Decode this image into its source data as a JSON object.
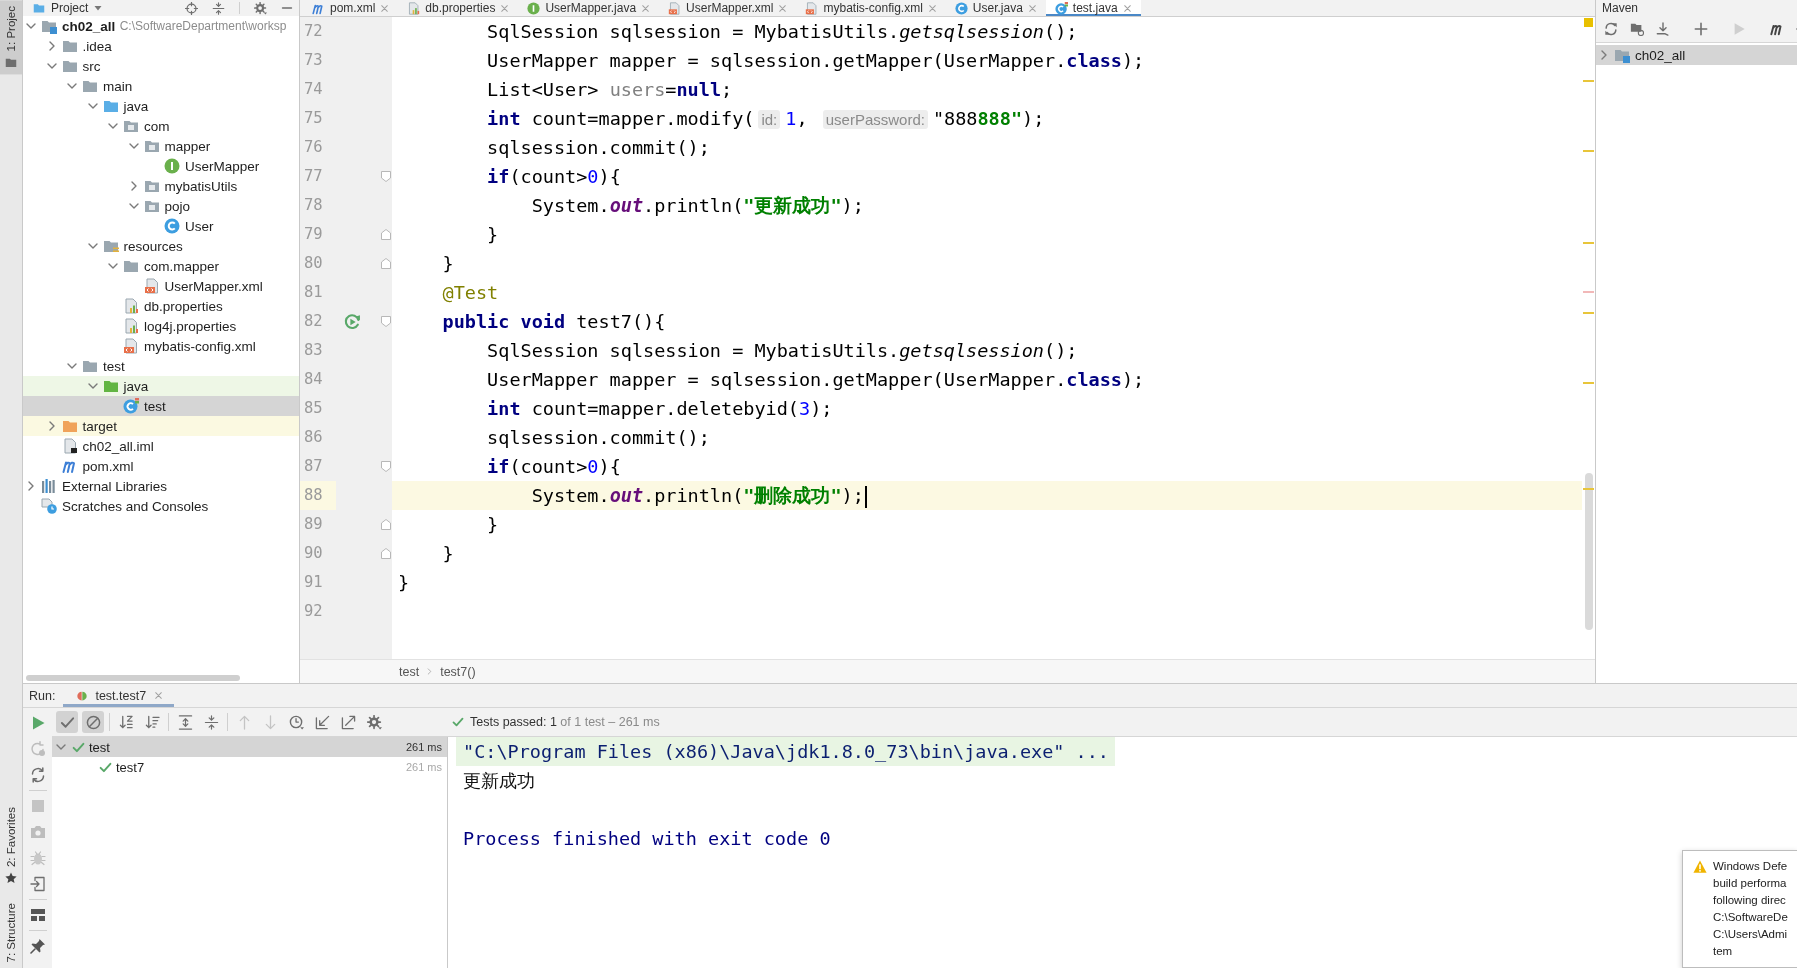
{
  "left_stripe": {
    "buttons": [
      {
        "label": "1: Projec",
        "kind": "project",
        "selected": true
      },
      {
        "label": "2: Favorites",
        "kind": "favorites",
        "selected": false
      },
      {
        "label": "7: Structure",
        "kind": "structure",
        "selected": false
      }
    ]
  },
  "project": {
    "title": "Project",
    "tree": [
      {
        "label": "ch02_all",
        "path": "C:\\SoftwareDepartment\\worksp",
        "kind": "module",
        "expanded": true,
        "selected": false,
        "children": [
          {
            "label": ".idea",
            "kind": "folder",
            "expanded": false,
            "selected": false
          },
          {
            "label": "src",
            "kind": "folder",
            "expanded": true,
            "selected": false,
            "children": [
              {
                "label": "main",
                "kind": "folder",
                "expanded": true,
                "selected": false,
                "children": [
                  {
                    "label": "java",
                    "kind": "source-folder",
                    "expanded": true,
                    "selected": false,
                    "children": [
                      {
                        "label": "com",
                        "kind": "package",
                        "expanded": true,
                        "selected": false,
                        "children": [
                          {
                            "label": "mapper",
                            "kind": "package",
                            "expanded": true,
                            "selected": false,
                            "children": [
                              {
                                "label": "UserMapper",
                                "kind": "interface",
                                "selected": false
                              }
                            ]
                          },
                          {
                            "label": "mybatisUtils",
                            "kind": "package",
                            "expanded": false,
                            "selected": false
                          },
                          {
                            "label": "pojo",
                            "kind": "package",
                            "expanded": true,
                            "selected": false,
                            "children": [
                              {
                                "label": "User",
                                "kind": "class",
                                "selected": false
                              }
                            ]
                          }
                        ]
                      }
                    ]
                  },
                  {
                    "label": "resources",
                    "kind": "resources-folder",
                    "expanded": true,
                    "selected": false,
                    "children": [
                      {
                        "label": "com.mapper",
                        "kind": "folder",
                        "expanded": true,
                        "selected": false,
                        "children": [
                          {
                            "label": "UserMapper.xml",
                            "kind": "xml",
                            "selected": false
                          }
                        ]
                      },
                      {
                        "label": "db.properties",
                        "kind": "properties",
                        "selected": false
                      },
                      {
                        "label": "log4j.properties",
                        "kind": "properties",
                        "selected": false
                      },
                      {
                        "label": "mybatis-config.xml",
                        "kind": "xml",
                        "selected": false
                      }
                    ]
                  }
                ]
              },
              {
                "label": "test",
                "kind": "folder",
                "expanded": true,
                "selected": false,
                "children": [
                  {
                    "label": "java",
                    "kind": "test-folder",
                    "expanded": true,
                    "selected": false,
                    "children": [
                      {
                        "label": "test",
                        "kind": "test-class",
                        "selected": true
                      }
                    ]
                  }
                ]
              }
            ]
          },
          {
            "label": "target",
            "kind": "excluded-folder",
            "expanded": false,
            "selected": false
          },
          {
            "label": "ch02_all.iml",
            "kind": "iml",
            "selected": false
          },
          {
            "label": "pom.xml",
            "kind": "maven",
            "selected": false
          }
        ]
      },
      {
        "label": "External Libraries",
        "kind": "libraries",
        "expanded": false,
        "selected": false
      },
      {
        "label": "Scratches and Consoles",
        "kind": "scratches",
        "selected": false
      }
    ]
  },
  "editor_tabs": [
    {
      "label": "pom.xml",
      "kind": "maven",
      "selected": false
    },
    {
      "label": "db.properties",
      "kind": "properties",
      "selected": false
    },
    {
      "label": "UserMapper.java",
      "kind": "interface",
      "selected": false
    },
    {
      "label": "UserMapper.xml",
      "kind": "xml",
      "selected": false
    },
    {
      "label": "mybatis-config.xml",
      "kind": "xml",
      "selected": false
    },
    {
      "label": "User.java",
      "kind": "class",
      "selected": false
    },
    {
      "label": "test.java",
      "kind": "test-class",
      "selected": true
    }
  ],
  "editor": {
    "lines": [
      {
        "number": "72",
        "current": false,
        "tokens": [
          {
            "kind": "plain",
            "text": "        SqlSession sqlsession = MybatisUtils."
          },
          {
            "kind": "italic",
            "text": "getsqlsession"
          },
          {
            "kind": "plain",
            "text": "();"
          }
        ]
      },
      {
        "number": "73",
        "current": false,
        "tokens": [
          {
            "kind": "plain",
            "text": "        UserMapper mapper = sqlsession.getMapper(UserMapper."
          },
          {
            "kind": "keyword",
            "text": "class"
          },
          {
            "kind": "plain",
            "text": ");"
          }
        ]
      },
      {
        "number": "74",
        "current": false,
        "tokens": [
          {
            "kind": "plain",
            "text": "        List<User> "
          },
          {
            "kind": "unused",
            "text": "users"
          },
          {
            "kind": "plain",
            "text": "="
          },
          {
            "kind": "keyword",
            "text": "null"
          },
          {
            "kind": "plain",
            "text": ";"
          }
        ]
      },
      {
        "number": "75",
        "current": false,
        "tokens": [
          {
            "kind": "keyword",
            "text": "        int"
          },
          {
            "kind": "plain",
            "text": " count=mapper.modify("
          },
          {
            "kind": "hint",
            "text": "id:"
          },
          {
            "kind": "number",
            "text": "1"
          },
          {
            "kind": "plain",
            "text": ", "
          },
          {
            "kind": "hint",
            "text": "userPassword:"
          },
          {
            "kind": "plain",
            "text": "\"888"
          },
          {
            "kind": "string",
            "text": "888\""
          },
          {
            "kind": "plain",
            "text": ");"
          }
        ]
      },
      {
        "number": "76",
        "current": false,
        "tokens": [
          {
            "kind": "plain",
            "text": "        sqlsession.commit();"
          }
        ]
      },
      {
        "number": "77",
        "current": false,
        "gutter": [
          {
            "kind": "fold-start"
          }
        ],
        "tokens": [
          {
            "kind": "keyword",
            "text": "        if"
          },
          {
            "kind": "plain",
            "text": "(count>"
          },
          {
            "kind": "number",
            "text": "0"
          },
          {
            "kind": "plain",
            "text": "){"
          }
        ]
      },
      {
        "number": "78",
        "current": false,
        "tokens": [
          {
            "kind": "plain",
            "text": "            System."
          },
          {
            "kind": "field",
            "text": "out"
          },
          {
            "kind": "plain",
            "text": ".println("
          },
          {
            "kind": "string",
            "text": "\"更新成功\""
          },
          {
            "kind": "plain",
            "text": ");"
          }
        ]
      },
      {
        "number": "79",
        "current": false,
        "gutter": [
          {
            "kind": "fold-end"
          }
        ],
        "tokens": [
          {
            "kind": "plain",
            "text": "        }"
          }
        ]
      },
      {
        "number": "80",
        "current": false,
        "gutter": [
          {
            "kind": "fold-end"
          }
        ],
        "tokens": [
          {
            "kind": "plain",
            "text": "    }"
          }
        ]
      },
      {
        "number": "81",
        "current": false,
        "tokens": [
          {
            "kind": "annotation",
            "text": "    @Test"
          }
        ]
      },
      {
        "number": "82",
        "current": false,
        "gutter": [
          {
            "kind": "run"
          },
          {
            "kind": "fold-start"
          }
        ],
        "tokens": [
          {
            "kind": "keyword",
            "text": "    public"
          },
          {
            "kind": "keyword",
            "text": " void"
          },
          {
            "kind": "plain",
            "text": " test7(){"
          }
        ]
      },
      {
        "number": "83",
        "current": false,
        "tokens": [
          {
            "kind": "plain",
            "text": "        SqlSession sqlsession = MybatisUtils."
          },
          {
            "kind": "italic",
            "text": "getsqlsession"
          },
          {
            "kind": "plain",
            "text": "();"
          }
        ]
      },
      {
        "number": "84",
        "current": false,
        "tokens": [
          {
            "kind": "plain",
            "text": "        UserMapper mapper = sqlsession.getMapper(UserMapper."
          },
          {
            "kind": "keyword",
            "text": "class"
          },
          {
            "kind": "plain",
            "text": ");"
          }
        ]
      },
      {
        "number": "85",
        "current": false,
        "tokens": [
          {
            "kind": "keyword",
            "text": "        int"
          },
          {
            "kind": "plain",
            "text": " count=mapper.deletebyid("
          },
          {
            "kind": "number",
            "text": "3"
          },
          {
            "kind": "plain",
            "text": ");"
          }
        ]
      },
      {
        "number": "86",
        "current": false,
        "tokens": [
          {
            "kind": "plain",
            "text": "        sqlsession.commit();"
          }
        ]
      },
      {
        "number": "87",
        "current": false,
        "gutter": [
          {
            "kind": "fold-start"
          }
        ],
        "tokens": [
          {
            "kind": "keyword",
            "text": "        if"
          },
          {
            "kind": "plain",
            "text": "(count>"
          },
          {
            "kind": "number",
            "text": "0"
          },
          {
            "kind": "plain",
            "text": "){"
          }
        ]
      },
      {
        "number": "88",
        "current": true,
        "tokens": [
          {
            "kind": "plain",
            "text": "            System."
          },
          {
            "kind": "field",
            "text": "out"
          },
          {
            "kind": "plain",
            "text": ".println("
          },
          {
            "kind": "string",
            "text": "\"删除成功\""
          },
          {
            "kind": "plain",
            "text": ");"
          }
        ]
      },
      {
        "number": "89",
        "current": false,
        "gutter": [
          {
            "kind": "fold-end"
          }
        ],
        "tokens": [
          {
            "kind": "plain",
            "text": "        }"
          }
        ]
      },
      {
        "number": "90",
        "current": false,
        "gutter": [
          {
            "kind": "fold-end"
          }
        ],
        "tokens": [
          {
            "kind": "plain",
            "text": "    }"
          }
        ]
      },
      {
        "number": "91",
        "current": false,
        "tokens": [
          {
            "kind": "plain",
            "text": "}"
          }
        ]
      },
      {
        "number": "92",
        "current": false
      }
    ],
    "breadcrumbs": [
      "test",
      "test7()"
    ]
  },
  "maven": {
    "title": "Maven",
    "tree": [
      {
        "label": "ch02_all",
        "kind": "module",
        "expanded": false,
        "selected": true
      }
    ]
  },
  "run": {
    "label": "Run:",
    "tabs": [
      {
        "label": "test.test7",
        "selected": true
      }
    ],
    "toolbar": [
      {
        "kind": "toggle-passed",
        "on": true,
        "disabled": false
      },
      {
        "kind": "toggle-ignored",
        "on": true,
        "disabled": false
      },
      {
        "kind": "sort-alpha",
        "disabled": false
      },
      {
        "kind": "sort-duration",
        "disabled": false
      },
      {
        "kind": "expand-all",
        "disabled": false
      },
      {
        "kind": "collapse-all",
        "disabled": false
      },
      {
        "kind": "previous",
        "disabled": true
      },
      {
        "kind": "next",
        "disabled": true
      },
      {
        "kind": "history",
        "disabled": false
      },
      {
        "kind": "import",
        "disabled": false
      },
      {
        "kind": "export",
        "disabled": false
      },
      {
        "kind": "settings",
        "disabled": false
      }
    ],
    "status": {
      "passed": true,
      "summary": "Tests passed: 1",
      "detail": "of 1 test – 261 ms"
    },
    "tests": [
      {
        "label": "test",
        "duration": "261 ms",
        "passed": true,
        "expanded": true,
        "selected": true,
        "children": [
          {
            "label": "test7",
            "duration": "261 ms",
            "passed": true,
            "selected": false
          }
        ]
      }
    ],
    "console": [
      {
        "kind": "command",
        "text": "\"C:\\Program Files (x86)\\Java\\jdk1.8.0_73\\bin\\java.exe\" ..."
      },
      {
        "kind": "output",
        "text": "更新成功"
      },
      {
        "kind": "exit",
        "text": "Process finished with exit code 0"
      }
    ]
  },
  "notification": {
    "lines": [
      "Windows Defe",
      "build performa",
      "following direc",
      "C:\\SoftwareDe",
      "C:\\Users\\Admi",
      "tem"
    ]
  }
}
